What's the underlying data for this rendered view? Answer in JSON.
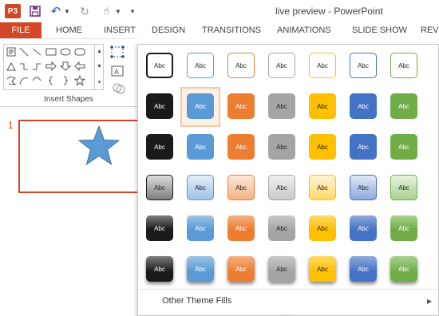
{
  "window": {
    "title": "live preview - PowerPoint"
  },
  "quick_access": {
    "app_logo": "P3",
    "icons": [
      "powerpoint-logo-icon",
      "save-icon",
      "undo-icon",
      "redo-icon",
      "touch-mode-icon",
      "customize-icon"
    ]
  },
  "ribbon_tabs": [
    "FILE",
    "HOME",
    "INSERT",
    "DESIGN",
    "TRANSITIONS",
    "ANIMATIONS",
    "SLIDE SHOW",
    "REVI"
  ],
  "ribbon": {
    "group_label": "Insert Shapes",
    "shape_icons": [
      "text-box-shape-icon",
      "line-shape-icon",
      "diagonal-line-shape-icon",
      "rectangle-shape-icon",
      "oval-shape-icon",
      "rounded-rectangle-shape-icon",
      "triangle-shape-icon",
      "elbow-connector-shape-icon",
      "curved-connector-shape-icon",
      "arrow-right-shape-icon",
      "arrow-left-shape-icon",
      "arrow-down-shape-icon",
      "freeform-shape-icon",
      "arc-shape-icon",
      "left-brace-shape-icon",
      "right-brace-shape-icon",
      "star-shape-icon"
    ]
  },
  "slides": {
    "number": "1",
    "thumbnail_shape": "star-shape-icon"
  },
  "style_gallery": {
    "swatch_label": "Abc",
    "row_styles": [
      "outline",
      "solid",
      "solid",
      "gradient-light",
      "gradient",
      "bevel"
    ],
    "theme_colors": [
      "#1a1a1a",
      "#5b9bd5",
      "#ed7d31",
      "#a5a5a5",
      "#ffc000",
      "#4472c4",
      "#70ad47"
    ],
    "light_colors": [
      "#7f7f7f",
      "#9dc3e6",
      "#f4b183",
      "#c9c9c9",
      "#ffd966",
      "#8faadc",
      "#a9d18e"
    ],
    "hovered": {
      "row": 1,
      "col": 1
    },
    "footer_label": "Other Theme Fills",
    "grip": "...."
  }
}
